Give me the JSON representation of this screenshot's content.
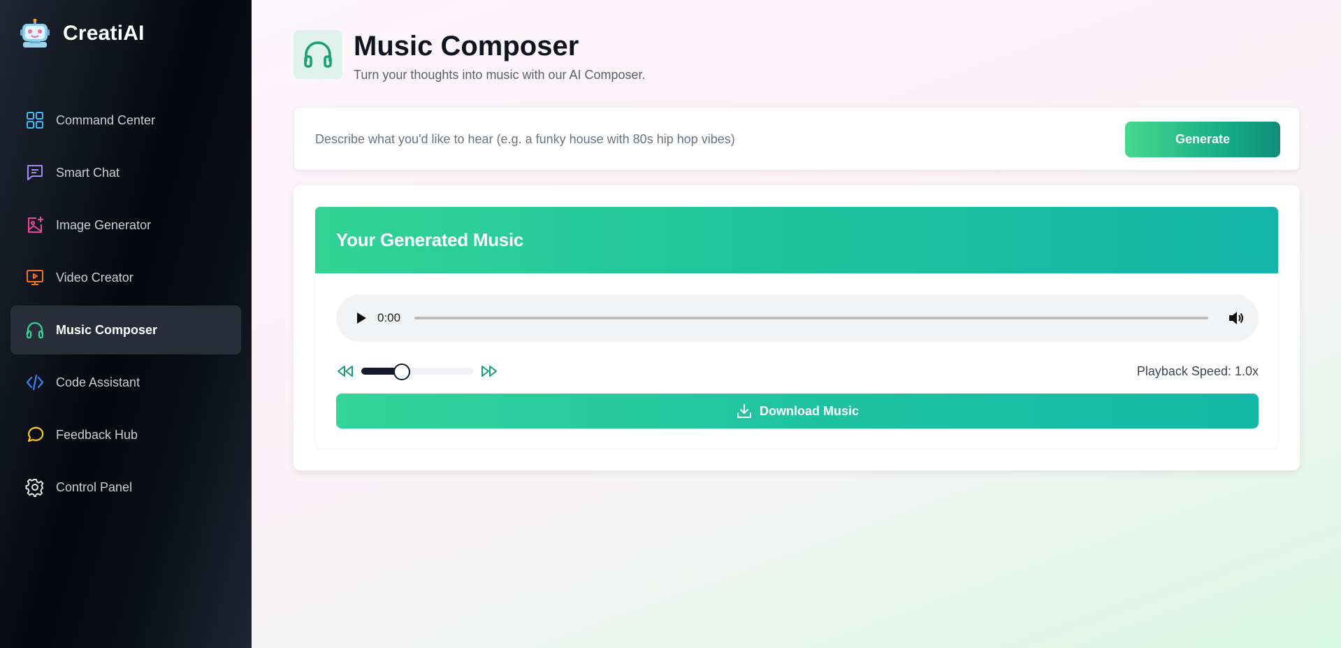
{
  "app": {
    "name": "CreatiAI",
    "logo_icon": "robot-icon"
  },
  "sidebar": {
    "items": [
      {
        "label": "Command Center",
        "icon": "grid-icon",
        "color": "#38bdf8",
        "active": false
      },
      {
        "label": "Smart Chat",
        "icon": "chat-icon",
        "color": "#a78bfa",
        "active": false
      },
      {
        "label": "Image Generator",
        "icon": "image-plus-icon",
        "color": "#ec4899",
        "active": false
      },
      {
        "label": "Video Creator",
        "icon": "video-icon",
        "color": "#f97316",
        "active": false
      },
      {
        "label": "Music Composer",
        "icon": "headphones-icon",
        "color": "#34d399",
        "active": true
      },
      {
        "label": "Code Assistant",
        "icon": "code-icon",
        "color": "#3b82f6",
        "active": false
      },
      {
        "label": "Feedback Hub",
        "icon": "speech-bubble-icon",
        "color": "#facc15",
        "active": false
      },
      {
        "label": "Control Panel",
        "icon": "gear-icon",
        "color": "#e5e7eb",
        "active": false
      }
    ]
  },
  "header": {
    "icon": "headphones-icon",
    "title": "Music Composer",
    "subtitle": "Turn your thoughts into music with our AI Composer."
  },
  "prompt": {
    "placeholder": "Describe what you'd like to hear (e.g. a funky house with 80s hip hop vibes)",
    "value": "",
    "generate_label": "Generate"
  },
  "result": {
    "title": "Your Generated Music",
    "player": {
      "current_time": "0:00",
      "progress": 0
    },
    "speed_slider": {
      "value": 1.0,
      "min": 0.5,
      "max": 2.0,
      "fill_fraction": 0.36
    },
    "speed_text": "Playback Speed: 1.0x",
    "download_label": "Download Music"
  },
  "colors": {
    "accent": "#10b981",
    "active_nav": "#272d39"
  }
}
